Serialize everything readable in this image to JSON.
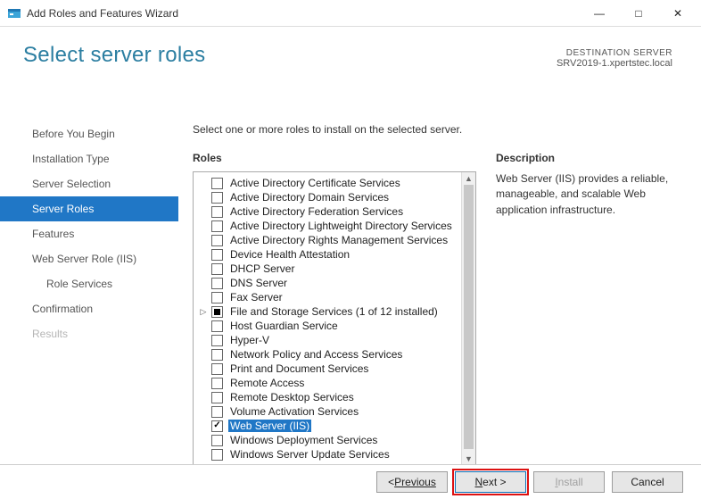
{
  "window": {
    "title": "Add Roles and Features Wizard"
  },
  "header": {
    "page_title": "Select server roles",
    "destination_label": "DESTINATION SERVER",
    "destination_value": "SRV2019-1.xpertstec.local"
  },
  "nav": {
    "items": [
      {
        "label": "Before You Begin"
      },
      {
        "label": "Installation Type"
      },
      {
        "label": "Server Selection"
      },
      {
        "label": "Server Roles",
        "active": true
      },
      {
        "label": "Features"
      },
      {
        "label": "Web Server Role (IIS)"
      },
      {
        "label": "Role Services",
        "sub": true
      },
      {
        "label": "Confirmation"
      },
      {
        "label": "Results",
        "disabled": true
      }
    ]
  },
  "main": {
    "instruction": "Select one or more roles to install on the selected server.",
    "roles_heading": "Roles",
    "description_heading": "Description",
    "description_text": "Web Server (IIS) provides a reliable, manageable, and scalable Web application infrastructure.",
    "roles": [
      {
        "label": "Active Directory Certificate Services"
      },
      {
        "label": "Active Directory Domain Services"
      },
      {
        "label": "Active Directory Federation Services"
      },
      {
        "label": "Active Directory Lightweight Directory Services"
      },
      {
        "label": "Active Directory Rights Management Services"
      },
      {
        "label": "Device Health Attestation"
      },
      {
        "label": "DHCP Server"
      },
      {
        "label": "DNS Server"
      },
      {
        "label": "Fax Server"
      },
      {
        "label": "File and Storage Services (1 of 12 installed)",
        "expandable": true,
        "state": "filled"
      },
      {
        "label": "Host Guardian Service"
      },
      {
        "label": "Hyper-V"
      },
      {
        "label": "Network Policy and Access Services"
      },
      {
        "label": "Print and Document Services"
      },
      {
        "label": "Remote Access"
      },
      {
        "label": "Remote Desktop Services"
      },
      {
        "label": "Volume Activation Services"
      },
      {
        "label": "Web Server (IIS)",
        "state": "checked",
        "selected": true
      },
      {
        "label": "Windows Deployment Services"
      },
      {
        "label": "Windows Server Update Services"
      }
    ]
  },
  "footer": {
    "previous": "Previous",
    "next": "Next >",
    "install": "Install",
    "cancel": "Cancel"
  }
}
